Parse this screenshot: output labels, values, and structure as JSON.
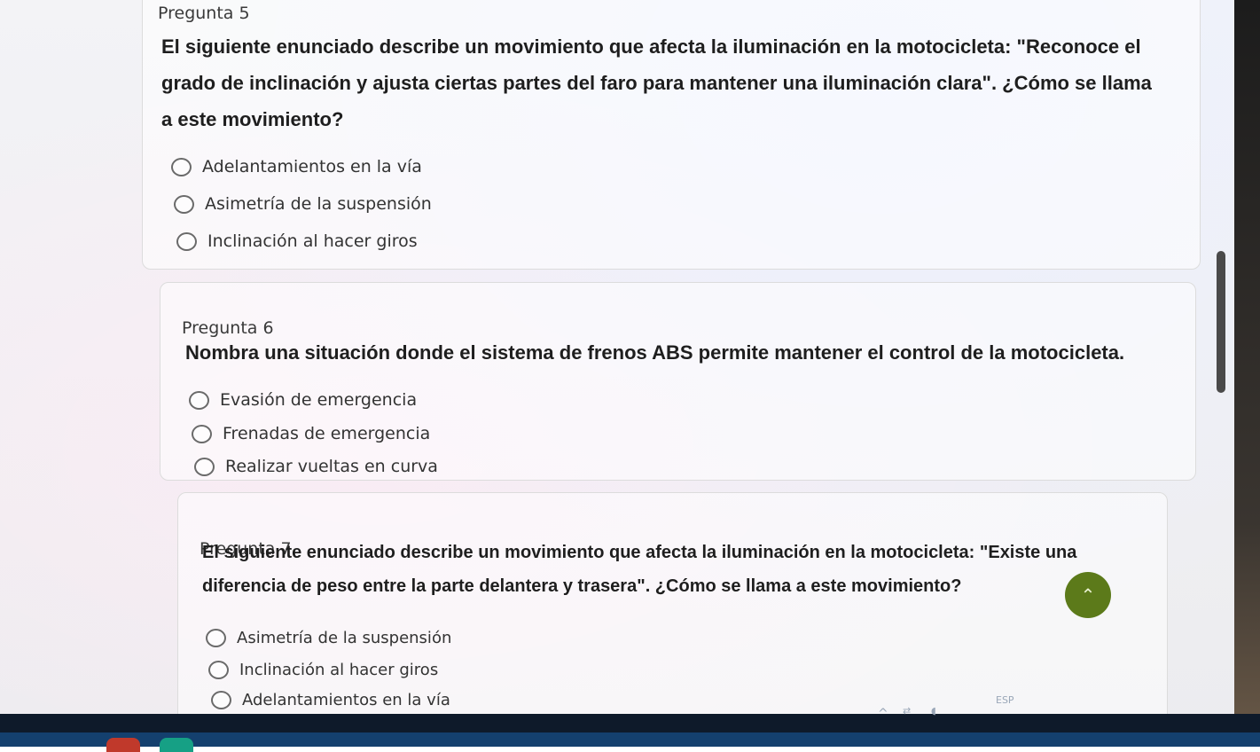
{
  "questions": [
    {
      "label": "Pregunta 5",
      "lines": [
        "El siguiente enunciado describe un movimiento que afecta la iluminación en la motocicleta: \"Reconoce el",
        "grado de inclinación y ajusta ciertas partes del faro para mantener una iluminación clara\". ¿Cómo se llama",
        "a este movimiento?"
      ],
      "options": [
        "Adelantamientos en la vía",
        "Asimetría de la suspensión",
        "Inclinación al hacer giros"
      ]
    },
    {
      "label": "Pregunta 6",
      "lines": [
        "Nombra una situación donde el sistema de frenos ABS permite mantener el control de la motocicleta."
      ],
      "options": [
        "Evasión de emergencia",
        "Frenadas de emergencia",
        "Realizar vueltas en curva"
      ]
    },
    {
      "label": "Pregunta 7",
      "lines": [
        "El siguiente enunciado describe un movimiento que afecta la iluminación en la motocicleta: \"Existe una",
        "diferencia de peso entre la parte delantera y trasera\". ¿Cómo se llama a este movimiento?"
      ],
      "options": [
        "Asimetría de la suspensión",
        "Inclinación al hacer giros",
        "Adelantamientos en la vía"
      ]
    }
  ],
  "scroll_top_icon": "double-chevron-up-icon",
  "scroll_top_glyph": "⌃",
  "taskbar": {
    "language": "ESP",
    "chevron_glyph": "^",
    "icons": [
      "chevron-up-icon",
      "network-icon",
      "volume-icon"
    ]
  },
  "colors": {
    "accent": "#5c7a1a",
    "taskbar": "#14406e"
  }
}
